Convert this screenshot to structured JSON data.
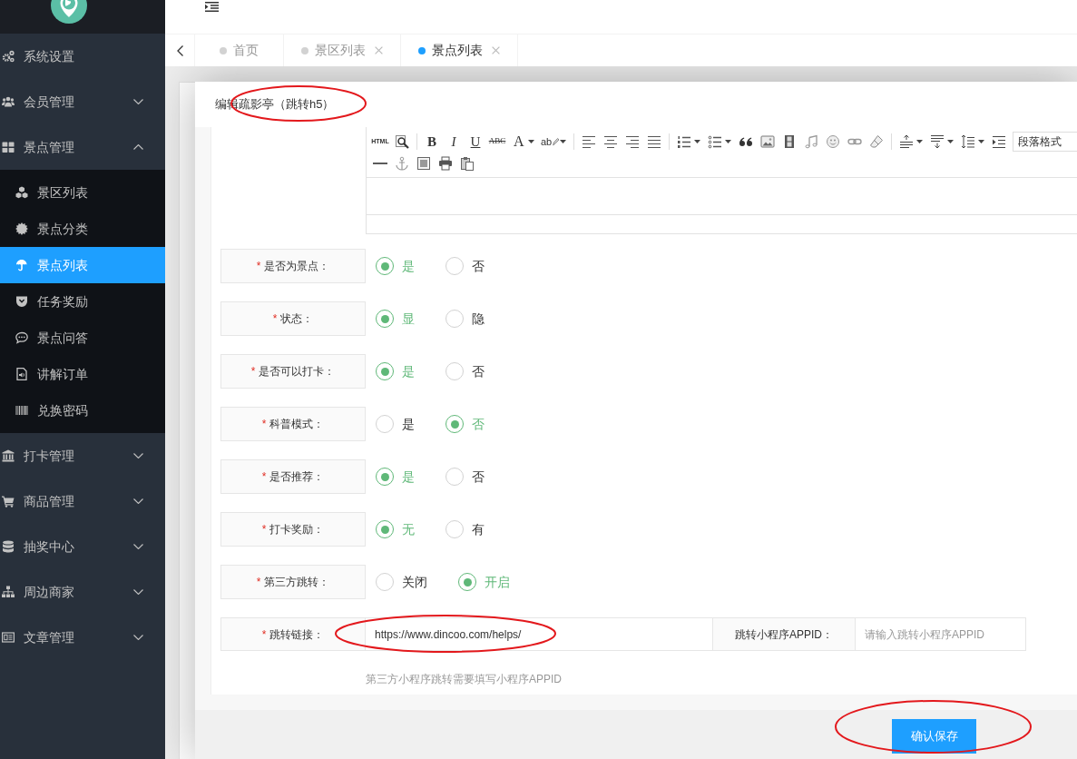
{
  "sidebar": {
    "items": [
      {
        "kind": "link",
        "label": "系统设置"
      },
      {
        "kind": "group",
        "label": "会员管理",
        "expanded": false
      },
      {
        "kind": "group",
        "label": "景点管理",
        "expanded": true,
        "children": [
          {
            "label": "景区列表",
            "selected": false
          },
          {
            "label": "景点分类",
            "selected": false
          },
          {
            "label": "景点列表",
            "selected": true
          },
          {
            "label": "任务奖励",
            "selected": false
          },
          {
            "label": "景点问答",
            "selected": false
          },
          {
            "label": "讲解订单",
            "selected": false
          },
          {
            "label": "兑换密码",
            "selected": false
          }
        ]
      },
      {
        "kind": "group",
        "label": "打卡管理",
        "expanded": false
      },
      {
        "kind": "group",
        "label": "商品管理",
        "expanded": false
      },
      {
        "kind": "group",
        "label": "抽奖中心",
        "expanded": false
      },
      {
        "kind": "group",
        "label": "周边商家",
        "expanded": false
      },
      {
        "kind": "group",
        "label": "文章管理",
        "expanded": false
      }
    ]
  },
  "tabs": [
    {
      "label": "首页",
      "selected": false,
      "closable": false
    },
    {
      "label": "景区列表",
      "selected": false,
      "closable": true
    },
    {
      "label": "景点列表",
      "selected": true,
      "closable": true
    }
  ],
  "modal": {
    "title": "编辑疏影亭（跳转h5）",
    "editor": {
      "html_button": "HTML",
      "bold_button": "B",
      "italic_button": "I",
      "underline_button": "U",
      "strikethrough_button": "ABC",
      "font_color_button": "A",
      "highlight_button": "ab",
      "paragraph_format": "段落格式"
    },
    "fields": [
      {
        "required_mark": "*",
        "label": "是否为景点：",
        "options": [
          {
            "label": "是",
            "selected": true
          },
          {
            "label": "否",
            "selected": false
          }
        ]
      },
      {
        "required_mark": "*",
        "label": "状态：",
        "options": [
          {
            "label": "显",
            "selected": true
          },
          {
            "label": "隐",
            "selected": false
          }
        ]
      },
      {
        "required_mark": "*",
        "label": "是否可以打卡：",
        "options": [
          {
            "label": "是",
            "selected": true
          },
          {
            "label": "否",
            "selected": false
          }
        ]
      },
      {
        "required_mark": "*",
        "label": "科普模式：",
        "options": [
          {
            "label": "是",
            "selected": false
          },
          {
            "label": "否",
            "selected": true
          }
        ]
      },
      {
        "required_mark": "*",
        "label": "是否推荐：",
        "options": [
          {
            "label": "是",
            "selected": true
          },
          {
            "label": "否",
            "selected": false
          }
        ]
      },
      {
        "required_mark": "*",
        "label": "打卡奖励：",
        "options": [
          {
            "label": "无",
            "selected": true
          },
          {
            "label": "有",
            "selected": false
          }
        ]
      },
      {
        "required_mark": "*",
        "label": "第三方跳转：",
        "options": [
          {
            "label": "关闭",
            "selected": false
          },
          {
            "label": "开启",
            "selected": true
          }
        ]
      }
    ],
    "link_fields": [
      {
        "required_mark": "*",
        "label": "跳转链接：",
        "value": "https://www.dincoo.com/helps/"
      },
      {
        "label": "跳转小程序APPID：",
        "placeholder": "请输入跳转小程序APPID"
      }
    ],
    "hint": "第三方小程序跳转需要填写小程序APPID",
    "save_button": "确认保存"
  },
  "annotations": [
    {
      "kind": "ellipse"
    },
    {
      "kind": "ellipse"
    },
    {
      "kind": "ellipse"
    }
  ]
}
